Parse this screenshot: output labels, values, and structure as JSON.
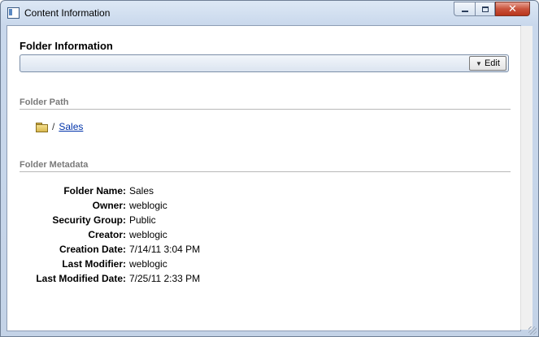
{
  "window": {
    "title": "Content Information",
    "controls": {
      "minimize": "",
      "maximize": "",
      "close": "✕"
    }
  },
  "folder_info": {
    "heading": "Folder Information",
    "edit_label": "Edit"
  },
  "folder_path": {
    "heading": "Folder Path",
    "separator": "/",
    "link": "Sales"
  },
  "folder_metadata": {
    "heading": "Folder Metadata",
    "rows": [
      {
        "label": "Folder Name:",
        "value": "Sales"
      },
      {
        "label": "Owner:",
        "value": "weblogic"
      },
      {
        "label": "Security Group:",
        "value": "Public"
      },
      {
        "label": "Creator:",
        "value": "weblogic"
      },
      {
        "label": "Creation Date:",
        "value": "7/14/11 3:04 PM"
      },
      {
        "label": "Last Modifier:",
        "value": "weblogic"
      },
      {
        "label": "Last Modified Date:",
        "value": "7/25/11 2:33 PM"
      }
    ]
  }
}
